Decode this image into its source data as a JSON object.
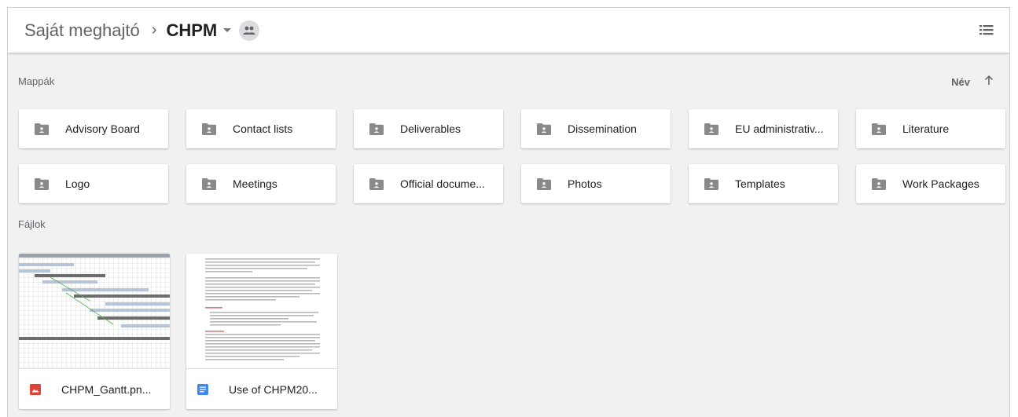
{
  "breadcrumb": {
    "root": "Saját meghajtó",
    "separator": "›",
    "current": "CHPM"
  },
  "icons": {
    "dropdown": "chevron-down-icon",
    "shared": "people-icon",
    "list_view": "list-view-icon",
    "sort": "arrow-up-icon",
    "folder": "shared-folder-icon",
    "image_file": "image-file-icon",
    "doc_file": "google-doc-icon"
  },
  "sections": {
    "folders_label": "Mappák",
    "files_label": "Fájlok",
    "sort_label": "Név"
  },
  "folders": [
    {
      "label": "Advisory Board"
    },
    {
      "label": "Contact lists"
    },
    {
      "label": "Deliverables"
    },
    {
      "label": "Dissemination"
    },
    {
      "label": "EU administrativ..."
    },
    {
      "label": "Literature"
    },
    {
      "label": "Logo"
    },
    {
      "label": "Meetings"
    },
    {
      "label": "Official docume..."
    },
    {
      "label": "Photos"
    },
    {
      "label": "Templates"
    },
    {
      "label": "Work Packages"
    }
  ],
  "files": [
    {
      "name": "CHPM_Gantt.pn...",
      "type": "image"
    },
    {
      "name": "Use of CHPM20...",
      "type": "document"
    }
  ],
  "colors": {
    "background": "#f1f1f1",
    "folder_icon": "#8a8a8a",
    "image_icon": "#db4437",
    "doc_icon": "#4285f4"
  }
}
